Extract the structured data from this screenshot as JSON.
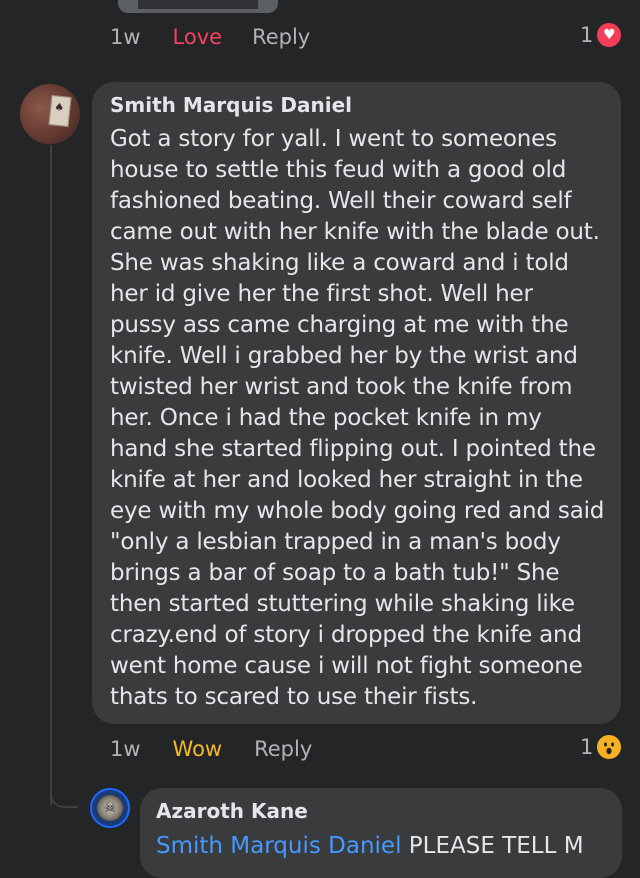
{
  "prev_comment": {
    "time": "1w",
    "reaction_label": "Love",
    "reply_label": "Reply",
    "reaction_count": "1",
    "reaction_icon": "heart-icon"
  },
  "comment": {
    "author": "Smith Marquis Daniel",
    "text": "Got a story for yall. I went to someones house to settle this feud with a good old fashioned beating. Well their coward self came out with her knife with the blade out. She was shaking like a coward and i told her id give her the first shot. Well her pussy ass came charging at me with the knife. Well i grabbed her by the wrist and twisted her wrist and took the knife from her. Once i had the pocket knife in my hand she started flipping out. I pointed the knife at her and looked her straight in the eye with my whole body going red and said \"only a lesbian trapped in a man's body brings a bar of soap to a bath tub!\" She then started stuttering while shaking like crazy.end of story i dropped the knife and went home cause i will not fight someone thats to scared to use their fists.",
    "time": "1w",
    "reaction_label": "Wow",
    "reply_label": "Reply",
    "reaction_count": "1",
    "reaction_icon": "wow-icon"
  },
  "reply": {
    "author": "Azaroth Kane",
    "mention": "Smith Marquis Daniel",
    "text": " PLEASE TELL M"
  },
  "colors": {
    "background": "#242526",
    "bubble": "#3a3b3c",
    "love": "#f3425f",
    "wow": "#f7b928",
    "mention": "#4599ff"
  }
}
